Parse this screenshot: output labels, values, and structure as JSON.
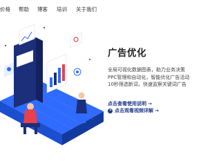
{
  "nav": {
    "items": [
      {
        "label": "价格"
      },
      {
        "label": "帮助"
      },
      {
        "label": "博客"
      },
      {
        "label": "培训"
      },
      {
        "label": "关于我们"
      }
    ]
  },
  "hero": {
    "title": "广告优化",
    "description_lines": [
      "全局可视化数据图表，助力业务决策",
      "PPC管理和自动化，智能优化广告活动",
      "10秒筛选新词，快速监察关键词广告"
    ]
  },
  "links": {
    "guide_label": "点击查看使用说明",
    "guide_arrow": "→",
    "video_label": "点击观看视频详解",
    "video_arrow": "→"
  },
  "colors": {
    "accent": "#1f3c88",
    "illustration_blue": "#2f6bff",
    "illustration_navy": "#1b2f7a",
    "illustration_red": "#e8404f"
  }
}
